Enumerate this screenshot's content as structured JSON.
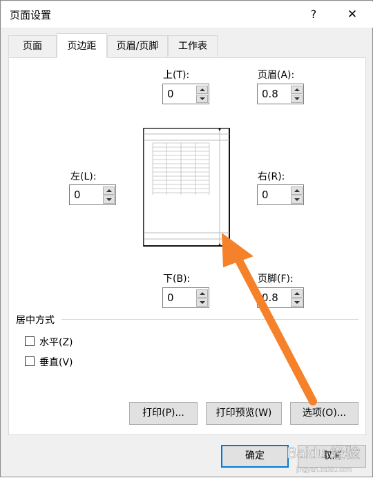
{
  "dialog": {
    "title": "页面设置",
    "help_label": "?",
    "close_label": "✕"
  },
  "tabs": [
    {
      "label": "页面"
    },
    {
      "label": "页边距"
    },
    {
      "label": "页眉/页脚"
    },
    {
      "label": "工作表"
    }
  ],
  "margins": {
    "top": {
      "label": "上(T):",
      "value": "0"
    },
    "header": {
      "label": "页眉(A):",
      "value": "0.8"
    },
    "left": {
      "label": "左(L):",
      "value": "0"
    },
    "right": {
      "label": "右(R):",
      "value": "0"
    },
    "bottom": {
      "label": "下(B):",
      "value": "0"
    },
    "footer": {
      "label": "页脚(F):",
      "value": "0.8"
    }
  },
  "centering": {
    "section_label": "居中方式",
    "horizontal_label": "水平(Z)",
    "vertical_label": "垂直(V)"
  },
  "buttons": {
    "print": "打印(P)...",
    "print_preview": "打印预览(W)",
    "options": "选项(O)...",
    "ok": "确定",
    "cancel": "取消"
  },
  "annotation": {
    "arrow_color": "#F5822A"
  },
  "watermark": {
    "text": "Baidu 经验",
    "sub": "jingyan.baidu.com"
  },
  "colors": {
    "focus_border": "#0078d7"
  }
}
